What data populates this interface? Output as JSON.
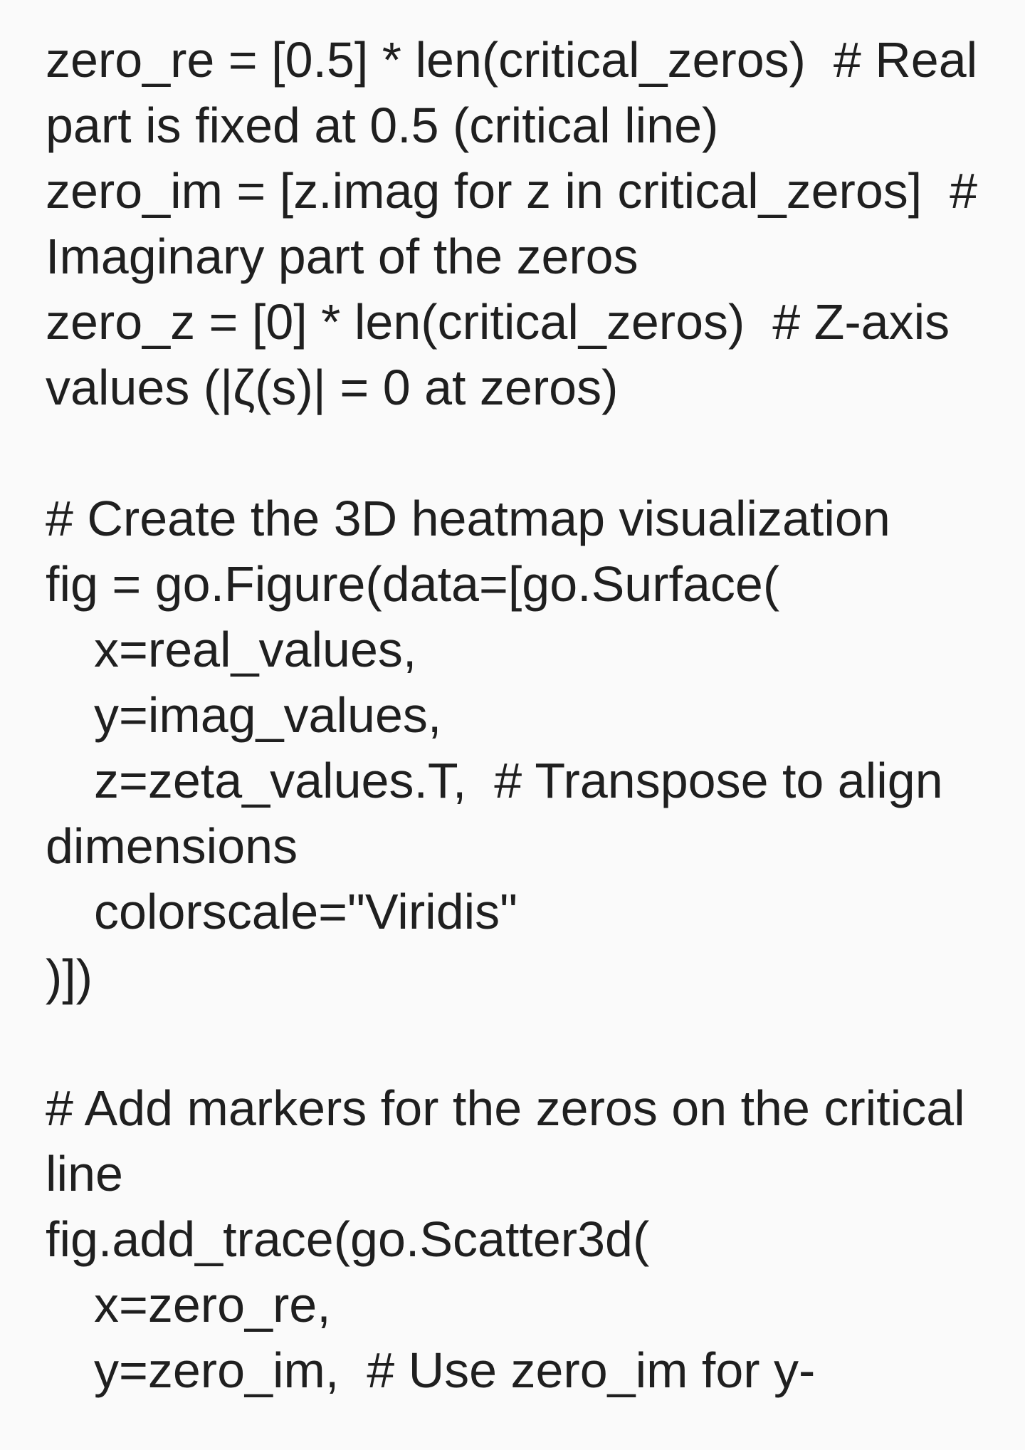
{
  "code": {
    "lines": [
      "zero_re = [0.5] * len(critical_zeros)  # Real",
      "part is fixed at 0.5 (critical line)",
      "zero_im = [z.imag for z in critical_zeros]  #",
      "Imaginary part of the zeros",
      "zero_z = [0] * len(critical_zeros)  # Z-axis",
      "values (|ζ(s)| = 0 at zeros)",
      "",
      "# Create the 3D heatmap visualization",
      "fig = go.Figure(data=[go.Surface(",
      "x=real_values,",
      "y=imag_values,",
      "z=zeta_values.T,  # Transpose to align",
      "dimensions",
      "colorscale=\"Viridis\"",
      ")])",
      "",
      "# Add markers for the zeros on the critical",
      "line",
      "fig.add_trace(go.Scatter3d(",
      "x=zero_re,",
      "y=zero_im,  # Use zero_im for y-"
    ]
  }
}
